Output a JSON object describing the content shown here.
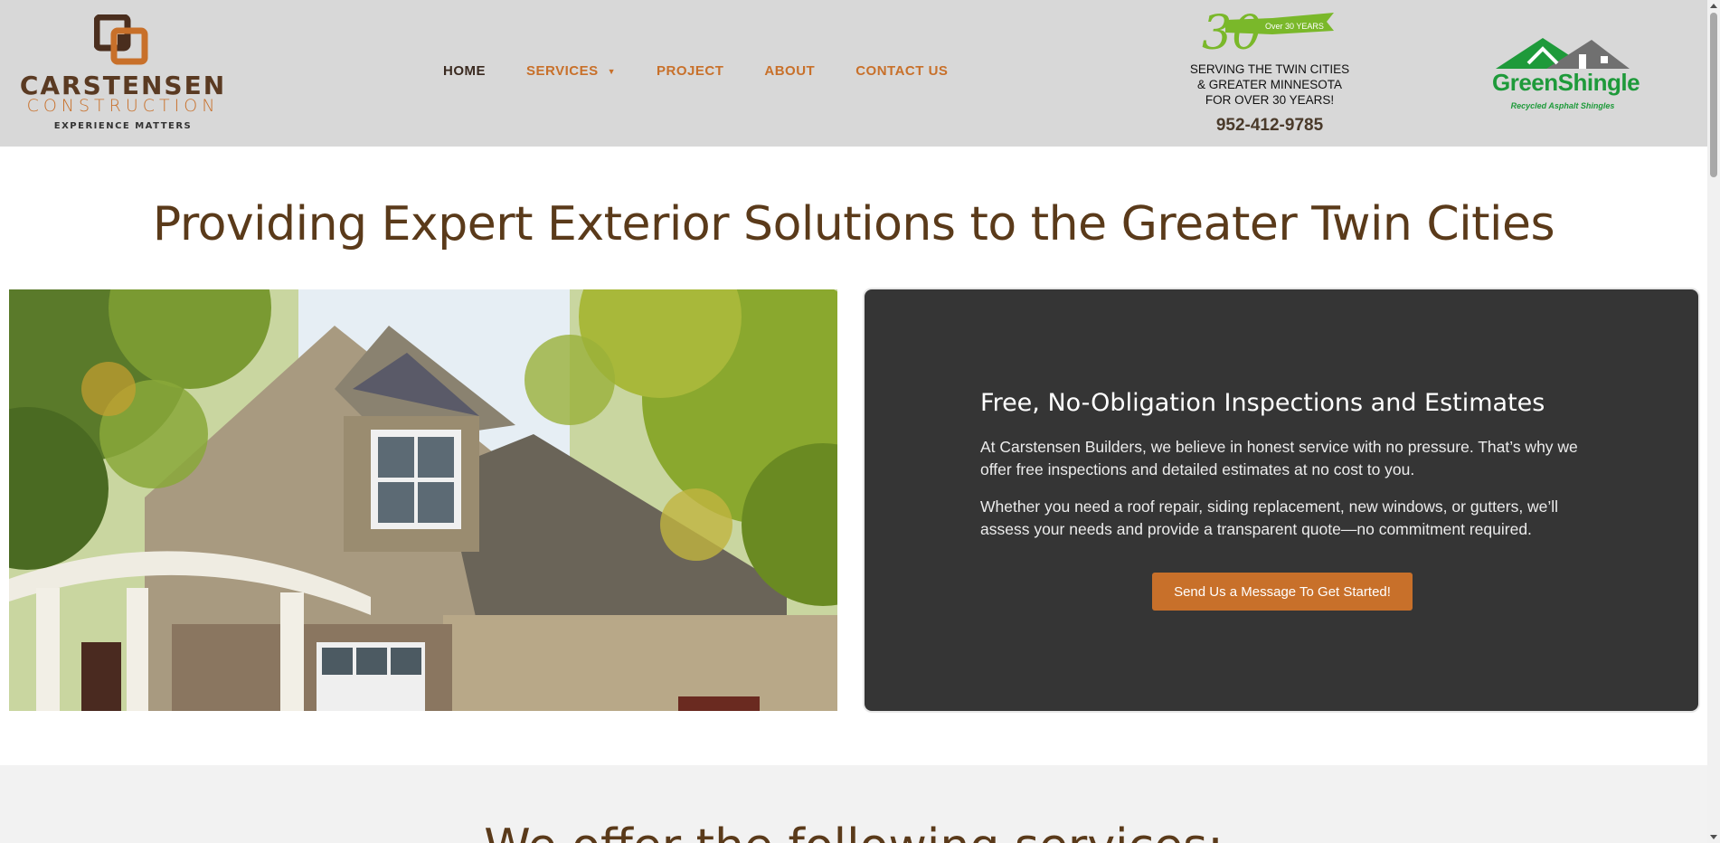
{
  "header": {
    "logo": {
      "wordmark": "CARSTENSEN",
      "sub": "CONSTRUCTION",
      "tagline": "EXPERIENCE MATTERS"
    },
    "nav": [
      {
        "label": "HOME",
        "active": true
      },
      {
        "label": "SERVICES",
        "has_dropdown": true
      },
      {
        "label": "PROJECT"
      },
      {
        "label": "ABOUT"
      },
      {
        "label": "CONTACT US"
      }
    ],
    "badge": {
      "number": "30",
      "ribbon": "Over 30 YEARS"
    },
    "serving_lines": [
      "SERVING THE TWIN CITIES",
      "& GREATER MINNESOTA",
      "FOR OVER 30 YEARS!"
    ],
    "phone": "952-412-9785",
    "partner": {
      "name": "GreenShingle",
      "sub": "Recycled Asphalt Shingles"
    }
  },
  "hero": {
    "title": "Providing Expert Exterior Solutions to the Greater Twin Cities"
  },
  "card": {
    "title": "Free, No-Obligation Inspections and Estimates",
    "p1": "At Carstensen Builders, we believe in honest service with no pressure. That’s why we offer free inspections and detailed estimates at no cost to you.",
    "p2": "Whether you need a roof repair, siding replacement, new windows, or gutters, we’ll assess your needs and provide a transparent quote—no commitment required.",
    "cta": "Send Us a Message To Get Started!"
  },
  "services": {
    "title": "We offer the following services:"
  },
  "colors": {
    "accent": "#c8702a",
    "brown": "#5a3a1a",
    "header_bg": "#d8d8d8",
    "card_bg": "#353535",
    "green": "#1e9a3a"
  }
}
